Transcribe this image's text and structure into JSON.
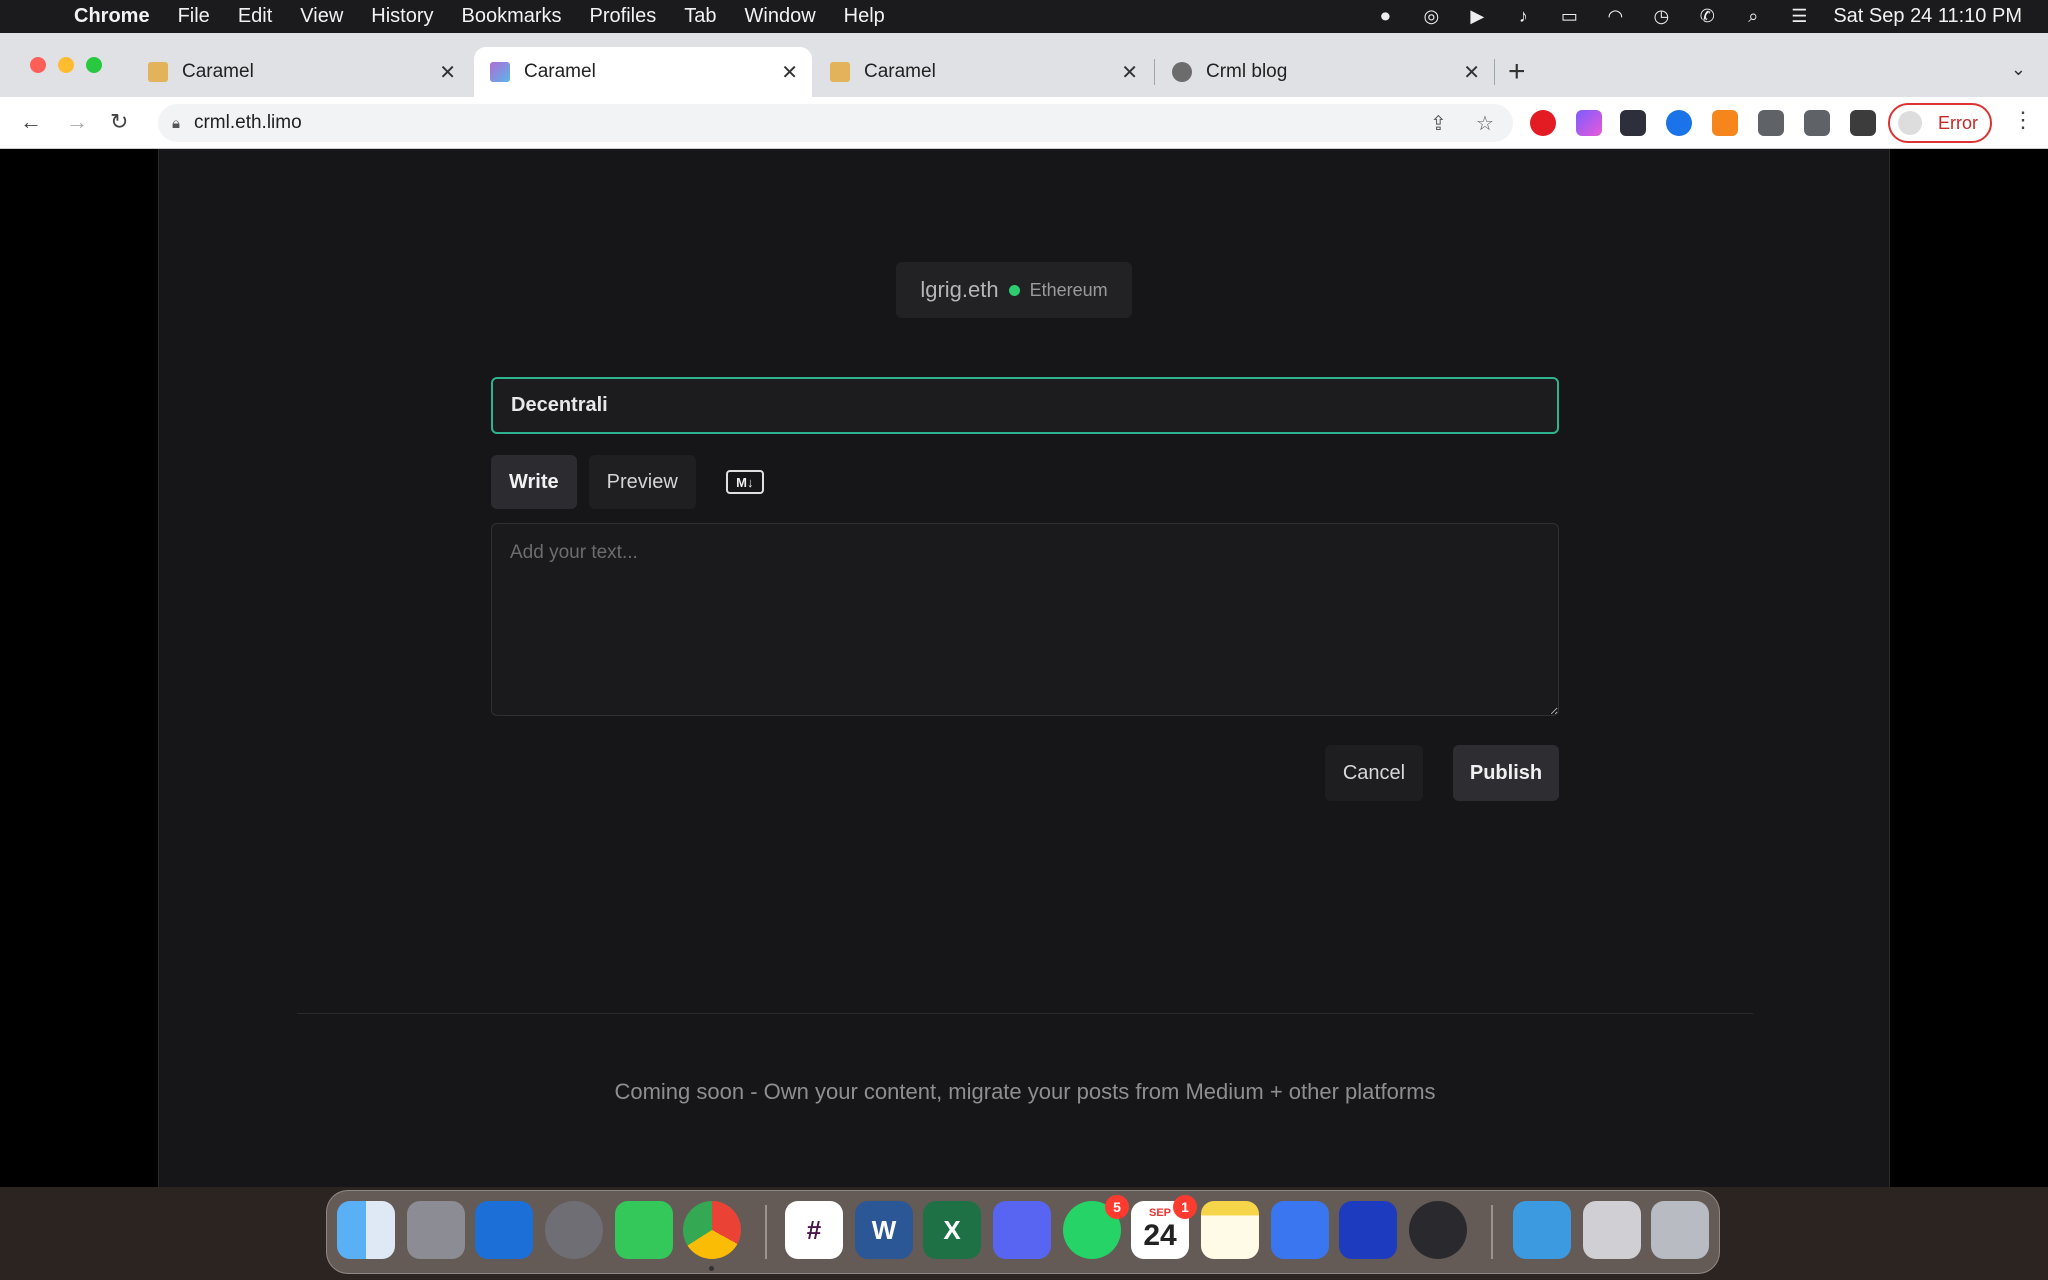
{
  "menubar": {
    "app": "Chrome",
    "items": [
      "File",
      "Edit",
      "View",
      "History",
      "Bookmarks",
      "Profiles",
      "Tab",
      "Window",
      "Help"
    ],
    "clock": "Sat Sep 24  11:10 PM"
  },
  "tabs": [
    {
      "title": "Caramel"
    },
    {
      "title": "Caramel"
    },
    {
      "title": "Caramel"
    },
    {
      "title": "Crml blog"
    }
  ],
  "address": {
    "url": "crml.eth.limo"
  },
  "profile": {
    "label": "Error"
  },
  "account": {
    "name": "lgrig.eth",
    "network": "Ethereum"
  },
  "editor": {
    "title_value": "Decentrali",
    "tab_write": "Write",
    "tab_preview": "Preview",
    "md_badge": "M↓",
    "body_placeholder": "Add your text...",
    "cancel_label": "Cancel",
    "publish_label": "Publish"
  },
  "footer": {
    "note": "Coming soon - Own your content, migrate your posts from Medium + other platforms"
  },
  "dock": {
    "whatsapp_badge": "5",
    "calendar_badge": "1",
    "calendar_month": "SEP",
    "calendar_day": "24"
  },
  "colors": {
    "accent_border": "#2fb28e",
    "online_dot": "#2ecc71",
    "page_bg": "#161618"
  }
}
